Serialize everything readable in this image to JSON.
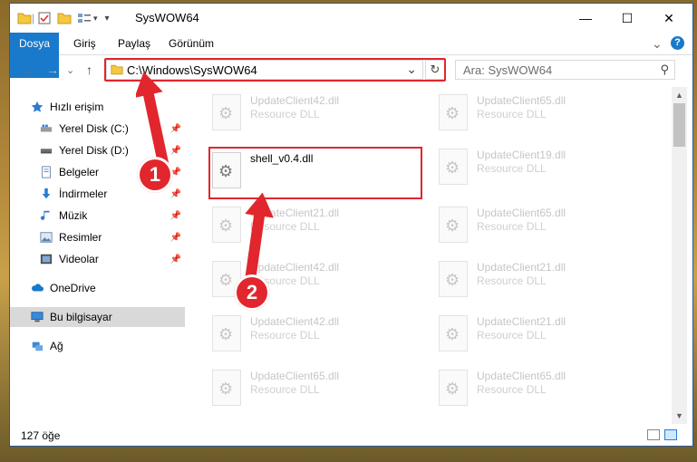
{
  "window": {
    "title": "SysWOW64",
    "minimize_glyph": "—",
    "maximize_glyph": "☐",
    "close_glyph": "✕"
  },
  "ribbon": {
    "tabs": [
      "Dosya",
      "Giriş",
      "Paylaş",
      "Görünüm"
    ],
    "help_glyph": "?",
    "expand_glyph": "⌄"
  },
  "address": {
    "path": "C:\\Windows\\SysWOW64",
    "refresh_glyph": "↻",
    "dropdown_glyph": "⌄"
  },
  "search": {
    "placeholder": "Ara: SysWOW64",
    "icon_glyph": "⚲"
  },
  "nav": {
    "back": "←",
    "forward": "→",
    "recent": "⌄",
    "up": "↑"
  },
  "sidebar": {
    "items": [
      {
        "label": "Hızlı erişim",
        "icon": "star-icon",
        "pinned": false
      },
      {
        "label": "Yerel Disk (C:)",
        "icon": "drive-icon",
        "pinned": true
      },
      {
        "label": "Yerel Disk (D:)",
        "icon": "drive-icon",
        "pinned": true
      },
      {
        "label": "Belgeler",
        "icon": "documents-icon",
        "pinned": true
      },
      {
        "label": "İndirmeler",
        "icon": "download-icon",
        "pinned": true
      },
      {
        "label": "Müzik",
        "icon": "music-icon",
        "pinned": true
      },
      {
        "label": "Resimler",
        "icon": "pictures-icon",
        "pinned": true
      },
      {
        "label": "Videolar",
        "icon": "video-icon",
        "pinned": true
      },
      {
        "label": "OneDrive",
        "icon": "cloud-icon",
        "pinned": false
      },
      {
        "label": "Bu bilgisayar",
        "icon": "computer-icon",
        "pinned": false
      },
      {
        "label": "Ağ",
        "icon": "network-icon",
        "pinned": false
      }
    ]
  },
  "files": {
    "highlight": {
      "name": "shell_v0.4.dll"
    },
    "left_column": [
      {
        "name": "UpdateClient42.dll",
        "desc": "Resource DLL"
      },
      {
        "name": "UpdateClient21.dll",
        "desc": "Resource DLL"
      },
      {
        "name": "UpdateClient42.dll",
        "desc": "Resource DLL"
      },
      {
        "name": "UpdateClient42.dll",
        "desc": "Resource DLL"
      },
      {
        "name": "UpdateClient65.dll",
        "desc": "Resource DLL"
      }
    ],
    "right_column": [
      {
        "name": "UpdateClient65.dll",
        "desc": "Resource DLL"
      },
      {
        "name": "UpdateClient19.dll",
        "desc": "Resource DLL"
      },
      {
        "name": "UpdateClient65.dll",
        "desc": "Resource DLL"
      },
      {
        "name": "UpdateClient21.dll",
        "desc": "Resource DLL"
      },
      {
        "name": "UpdateClient21.dll",
        "desc": "Resource DLL"
      },
      {
        "name": "UpdateClient65.dll",
        "desc": "Resource DLL"
      }
    ]
  },
  "status": {
    "count": "127 öğe"
  },
  "annotations": {
    "step1": "1",
    "step2": "2",
    "accent": "#e1262d"
  }
}
